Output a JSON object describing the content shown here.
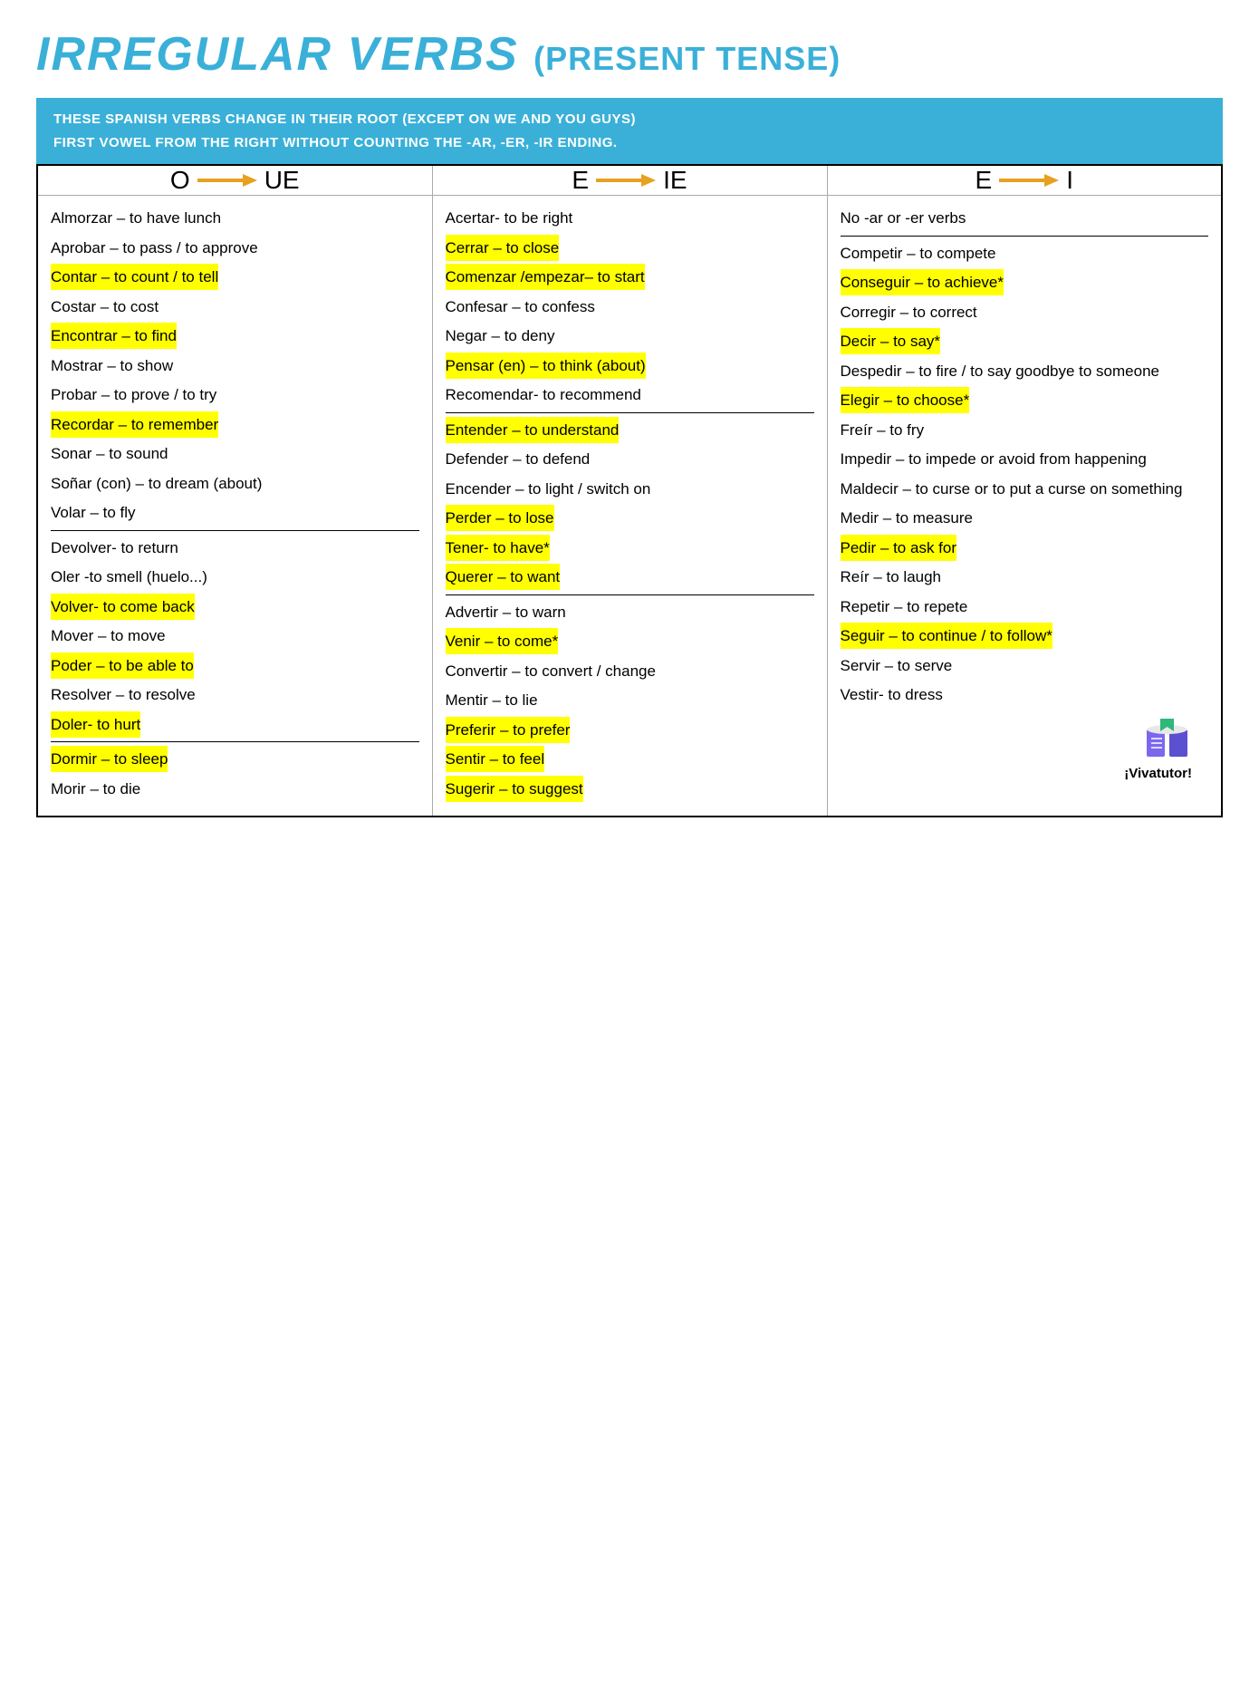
{
  "title": {
    "main": "IRREGULAR VERBS",
    "sub": "(PRESENT TENSE)"
  },
  "info": {
    "line1": "THESE SPANISH VERBS CHANGE IN THEIR ROOT (EXCEPT ON WE AND YOU GUYS)",
    "line2": "FIRST VOWEL FROM THE RIGHT WITHOUT COUNTING THE -AR, -ER, -IR ENDING."
  },
  "columns": [
    {
      "from": "O",
      "to": "UE",
      "verbs": [
        {
          "text": "Almorzar – to have lunch",
          "hl": false,
          "border_bottom": false,
          "border_top": false
        },
        {
          "text": "Aprobar – to pass / to approve",
          "hl": false,
          "border_bottom": false,
          "border_top": false
        },
        {
          "text": "Contar – to count / to tell",
          "hl": true,
          "border_bottom": false,
          "border_top": false
        },
        {
          "text": "Costar – to cost",
          "hl": false,
          "border_bottom": false,
          "border_top": false
        },
        {
          "text": "Encontrar – to find",
          "hl": true,
          "border_bottom": false,
          "border_top": false
        },
        {
          "text": "Mostrar – to show",
          "hl": false,
          "border_bottom": false,
          "border_top": false
        },
        {
          "text": "Probar – to prove / to try",
          "hl": false,
          "border_bottom": false,
          "border_top": false
        },
        {
          "text": "Recordar – to remember",
          "hl": true,
          "border_bottom": false,
          "border_top": false
        },
        {
          "text": "Sonar – to sound",
          "hl": false,
          "border_bottom": false,
          "border_top": false
        },
        {
          "text": "Soñar (con) – to dream (about)",
          "hl": false,
          "border_bottom": false,
          "border_top": false
        },
        {
          "text": "Volar – to fly",
          "hl": false,
          "border_bottom": true,
          "border_top": false
        },
        {
          "text": "Devolver- to return",
          "hl": false,
          "border_bottom": false,
          "border_top": false
        },
        {
          "text": "Oler -to smell  (huelo...)",
          "hl": false,
          "border_bottom": false,
          "border_top": false
        },
        {
          "text": "Volver- to come back",
          "hl": true,
          "border_bottom": false,
          "border_top": false
        },
        {
          "text": "Mover – to move",
          "hl": false,
          "border_bottom": false,
          "border_top": false
        },
        {
          "text": "Poder – to be able to",
          "hl": true,
          "border_bottom": false,
          "border_top": false
        },
        {
          "text": "Resolver – to resolve",
          "hl": false,
          "border_bottom": false,
          "border_top": false
        },
        {
          "text": "Doler- to hurt",
          "hl": true,
          "border_bottom": true,
          "border_top": false
        },
        {
          "text": "Dormir – to sleep",
          "hl": true,
          "border_bottom": false,
          "border_top": false
        },
        {
          "text": "Morir – to die",
          "hl": false,
          "border_bottom": false,
          "border_top": false
        }
      ]
    },
    {
      "from": "E",
      "to": "IE",
      "verbs": [
        {
          "text": "Acertar- to be right",
          "hl": false,
          "border_bottom": false,
          "border_top": false
        },
        {
          "text": "Cerrar – to close",
          "hl": true,
          "border_bottom": false,
          "border_top": false
        },
        {
          "text": "Comenzar /empezar– to start",
          "hl": true,
          "border_bottom": false,
          "border_top": false
        },
        {
          "text": "Confesar – to confess",
          "hl": false,
          "border_bottom": false,
          "border_top": false
        },
        {
          "text": "Negar – to deny",
          "hl": false,
          "border_bottom": false,
          "border_top": false
        },
        {
          "text": "Pensar (en) – to think (about)",
          "hl": true,
          "border_bottom": false,
          "border_top": false
        },
        {
          "text": "Recomendar- to recommend",
          "hl": false,
          "border_bottom": true,
          "border_top": false
        },
        {
          "text": "Entender – to understand",
          "hl": true,
          "border_bottom": false,
          "border_top": false
        },
        {
          "text": "Defender – to defend",
          "hl": false,
          "border_bottom": false,
          "border_top": false
        },
        {
          "text": "Encender – to light / switch on",
          "hl": false,
          "border_bottom": false,
          "border_top": false
        },
        {
          "text": "Perder – to lose",
          "hl": true,
          "border_bottom": false,
          "border_top": false
        },
        {
          "text": "Tener- to have*",
          "hl": true,
          "border_bottom": false,
          "border_top": false
        },
        {
          "text": "Querer – to want",
          "hl": true,
          "border_bottom": true,
          "border_top": false
        },
        {
          "text": "Advertir – to warn",
          "hl": false,
          "border_bottom": false,
          "border_top": false
        },
        {
          "text": "Venir – to come*",
          "hl": true,
          "border_bottom": false,
          "border_top": false
        },
        {
          "text": "Convertir – to convert / change",
          "hl": false,
          "border_bottom": false,
          "border_top": false
        },
        {
          "text": "Mentir – to lie",
          "hl": false,
          "border_bottom": false,
          "border_top": false
        },
        {
          "text": "Preferir – to prefer",
          "hl": true,
          "border_bottom": false,
          "border_top": false
        },
        {
          "text": "Sentir – to feel",
          "hl": true,
          "border_bottom": false,
          "border_top": false
        },
        {
          "text": "Sugerir – to suggest",
          "hl": true,
          "border_bottom": false,
          "border_top": false
        }
      ]
    },
    {
      "from": "E",
      "to": "I",
      "verbs": [
        {
          "text": "No -ar or -er verbs",
          "hl": false,
          "border_bottom": true,
          "border_top": false
        },
        {
          "text": "Competir – to compete",
          "hl": false,
          "border_bottom": false,
          "border_top": false
        },
        {
          "text": "Conseguir – to achieve*",
          "hl": true,
          "border_bottom": false,
          "border_top": false
        },
        {
          "text": "Corregir – to correct",
          "hl": false,
          "border_bottom": false,
          "border_top": false
        },
        {
          "text": "Decir – to say*",
          "hl": true,
          "border_bottom": false,
          "border_top": false
        },
        {
          "text": "Despedir – to fire / to say goodbye to someone",
          "hl": false,
          "border_bottom": false,
          "border_top": false
        },
        {
          "text": "Elegir – to choose*",
          "hl": true,
          "border_bottom": false,
          "border_top": false
        },
        {
          "text": "Freír – to fry",
          "hl": false,
          "border_bottom": false,
          "border_top": false
        },
        {
          "text": "Impedir – to impede or avoid from happening",
          "hl": false,
          "border_bottom": false,
          "border_top": false
        },
        {
          "text": "Maldecir –  to curse or to put a curse on something",
          "hl": false,
          "border_bottom": false,
          "border_top": false
        },
        {
          "text": "Medir – to measure",
          "hl": false,
          "border_bottom": false,
          "border_top": false
        },
        {
          "text": "Pedir – to ask for",
          "hl": true,
          "border_bottom": false,
          "border_top": false
        },
        {
          "text": "Reír – to laugh",
          "hl": false,
          "border_bottom": false,
          "border_top": false
        },
        {
          "text": "Repetir – to repete",
          "hl": false,
          "border_bottom": false,
          "border_top": false
        },
        {
          "text": "Seguir – to continue / to follow*",
          "hl": true,
          "border_bottom": false,
          "border_top": false
        },
        {
          "text": "Servir – to serve",
          "hl": false,
          "border_bottom": false,
          "border_top": false
        },
        {
          "text": "Vestir- to dress",
          "hl": false,
          "border_bottom": false,
          "border_top": false
        }
      ]
    }
  ],
  "vivatutor": "¡Vivatutor!",
  "colors": {
    "accent": "#3ab0d8",
    "highlight": "#ffff00"
  }
}
